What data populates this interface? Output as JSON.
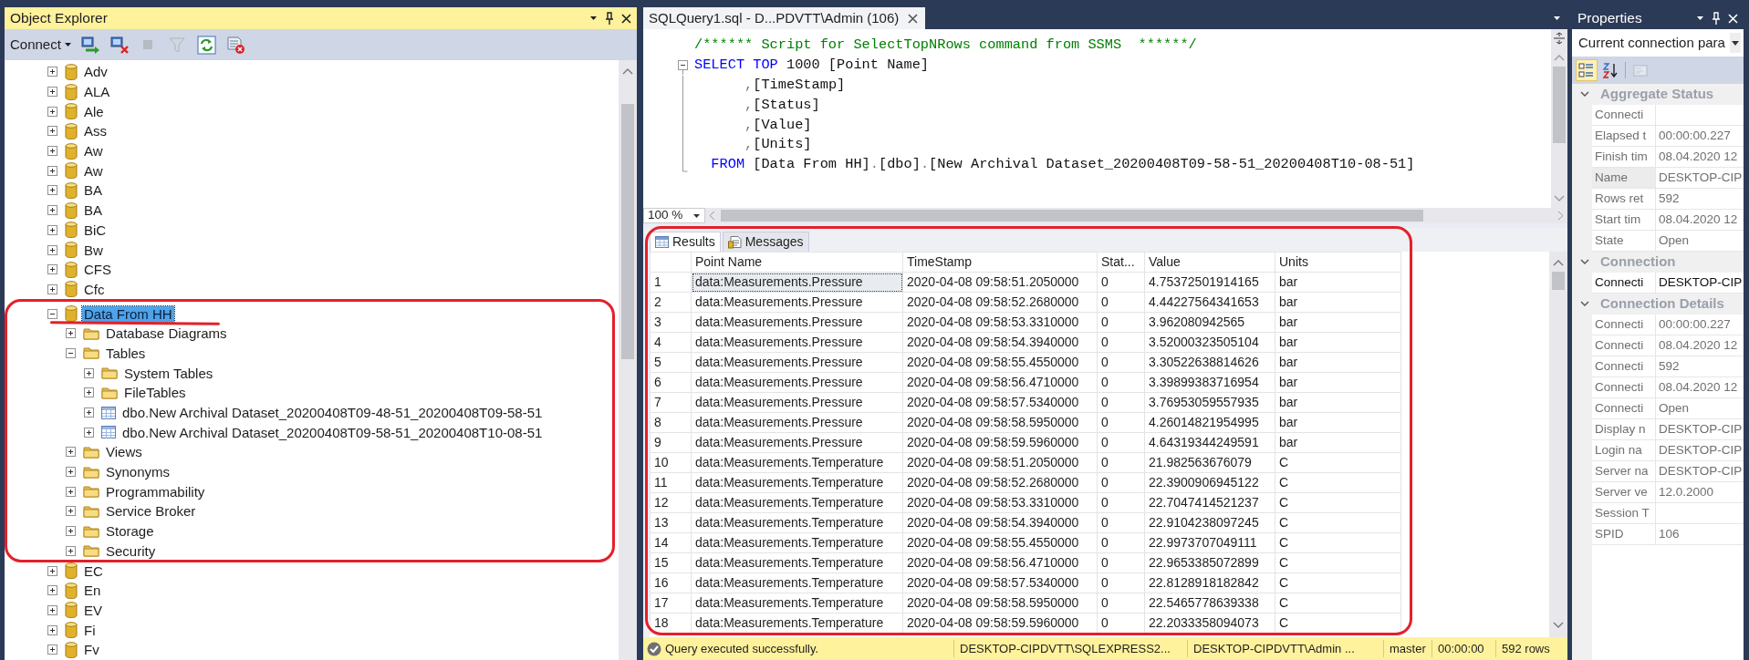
{
  "object_explorer": {
    "title": "Object Explorer",
    "active": true,
    "toolbar": {
      "connect": "Connect",
      "buttons": [
        {
          "kind": "connect",
          "disabled": false
        },
        {
          "kind": "disconnect",
          "disabled": false
        },
        {
          "kind": "stop",
          "disabled": true
        },
        {
          "kind": "filter",
          "disabled": true
        },
        {
          "kind": "refresh",
          "disabled": false
        },
        {
          "kind": "remove",
          "disabled": false
        }
      ]
    },
    "tree": [
      {
        "label": "Adv",
        "kind": "database",
        "expanded": false,
        "selected": false
      },
      {
        "label": "ALA",
        "kind": "database",
        "expanded": false,
        "selected": false
      },
      {
        "label": "Ale",
        "kind": "database",
        "expanded": false,
        "selected": false
      },
      {
        "label": "Ass",
        "kind": "database",
        "expanded": false,
        "selected": false
      },
      {
        "label": "Aw",
        "kind": "database",
        "expanded": false,
        "selected": false
      },
      {
        "label": "Aw",
        "kind": "database",
        "expanded": false,
        "selected": false
      },
      {
        "label": "BA",
        "kind": "database",
        "expanded": false,
        "selected": false
      },
      {
        "label": "BA",
        "kind": "database",
        "expanded": false,
        "selected": false
      },
      {
        "label": "BiC",
        "kind": "database",
        "expanded": false,
        "selected": false
      },
      {
        "label": "Bw",
        "kind": "database",
        "expanded": false,
        "selected": false
      },
      {
        "label": "CFS",
        "kind": "database",
        "expanded": false,
        "selected": false
      },
      {
        "label": "Cfc",
        "kind": "database",
        "expanded": false,
        "selected": false
      },
      {
        "label": "Data From HH",
        "kind": "database",
        "expanded": true,
        "selected": true,
        "outlined": true,
        "underlined": true,
        "children": [
          {
            "label": "Database Diagrams",
            "kind": "folder",
            "expanded": false,
            "selected": false
          },
          {
            "label": "Tables",
            "kind": "folder",
            "expanded": true,
            "selected": false,
            "children": [
              {
                "label": "System Tables",
                "kind": "folder",
                "expanded": false,
                "selected": false
              },
              {
                "label": "FileTables",
                "kind": "folder",
                "expanded": false,
                "selected": false
              },
              {
                "label": "dbo.New Archival Dataset_20200408T09-48-51_20200408T09-58-51",
                "kind": "table",
                "expanded": false,
                "selected": false
              },
              {
                "label": "dbo.New Archival Dataset_20200408T09-58-51_20200408T10-08-51",
                "kind": "table",
                "expanded": false,
                "selected": false
              }
            ]
          },
          {
            "label": "Views",
            "kind": "folder",
            "expanded": false,
            "selected": false
          },
          {
            "label": "Synonyms",
            "kind": "folder",
            "expanded": false,
            "selected": false
          },
          {
            "label": "Programmability",
            "kind": "folder",
            "expanded": false,
            "selected": false
          },
          {
            "label": "Service Broker",
            "kind": "folder",
            "expanded": false,
            "selected": false
          },
          {
            "label": "Storage",
            "kind": "folder",
            "expanded": false,
            "selected": false
          },
          {
            "label": "Security",
            "kind": "folder",
            "expanded": false,
            "selected": false
          }
        ]
      },
      {
        "label": "EC",
        "kind": "database",
        "expanded": false,
        "selected": false
      },
      {
        "label": "En",
        "kind": "database",
        "expanded": false,
        "selected": false
      },
      {
        "label": "EV",
        "kind": "database",
        "expanded": false,
        "selected": false
      },
      {
        "label": "Fi",
        "kind": "database",
        "expanded": false,
        "selected": false
      },
      {
        "label": "Fv",
        "kind": "database",
        "expanded": false,
        "selected": false
      }
    ]
  },
  "editor": {
    "tab": {
      "title": "SQLQuery1.sql - D...PDVTT\\Admin (106)",
      "selected": true
    },
    "fold_expanded": true,
    "code": [
      {
        "kind": "plain",
        "tokens": [
          {
            "text": "/****** Script for SelectTopNRows command from SSMS  ******/",
            "kind": "comment"
          }
        ]
      },
      {
        "kind": "fold-start",
        "tokens": [
          {
            "text": "SELECT",
            "kind": "keyword"
          },
          {
            "text": " TOP",
            "kind": "keyword"
          },
          {
            "text": " 1000 [Point Name]",
            "kind": "plain"
          }
        ]
      },
      {
        "kind": "fold-inside",
        "tokens": [
          {
            "text": "      ,",
            "kind": "punct"
          },
          {
            "text": "[TimeStamp]",
            "kind": "plain"
          }
        ]
      },
      {
        "kind": "fold-inside",
        "tokens": [
          {
            "text": "      ,",
            "kind": "punct"
          },
          {
            "text": "[Status]",
            "kind": "plain"
          }
        ]
      },
      {
        "kind": "fold-inside",
        "tokens": [
          {
            "text": "      ,",
            "kind": "punct"
          },
          {
            "text": "[Value]",
            "kind": "plain"
          }
        ]
      },
      {
        "kind": "fold-inside",
        "tokens": [
          {
            "text": "      ,",
            "kind": "punct"
          },
          {
            "text": "[Units]",
            "kind": "plain"
          }
        ]
      },
      {
        "kind": "fold-end",
        "tokens": [
          {
            "text": "  FROM",
            "kind": "keyword"
          },
          {
            "text": " [Data From HH]",
            "kind": "plain"
          },
          {
            "text": ".",
            "kind": "punct"
          },
          {
            "text": "[dbo]",
            "kind": "plain"
          },
          {
            "text": ".",
            "kind": "punct"
          },
          {
            "text": "[New Archival Dataset_20200408T09-58-51_20200408T10-08-51]",
            "kind": "plain"
          }
        ]
      }
    ],
    "zoom": "100 %"
  },
  "results": {
    "outlined": true,
    "tabs": [
      {
        "label": "Results",
        "kind": "grid",
        "selected": true
      },
      {
        "label": "Messages",
        "kind": "messages",
        "selected": false
      }
    ],
    "columns": [
      "Point Name",
      "TimeStamp",
      "Stat...",
      "Value",
      "Units"
    ],
    "rows": [
      {
        "num": "1",
        "selected": true,
        "cells": [
          "data:Measurements.Pressure",
          "2020-04-08 09:58:51.2050000",
          "0",
          "4.75372501914165",
          "bar"
        ]
      },
      {
        "num": "2",
        "selected": false,
        "cells": [
          "data:Measurements.Pressure",
          "2020-04-08 09:58:52.2680000",
          "0",
          "4.44227564341653",
          "bar"
        ]
      },
      {
        "num": "3",
        "selected": false,
        "cells": [
          "data:Measurements.Pressure",
          "2020-04-08 09:58:53.3310000",
          "0",
          "3.962080942565",
          "bar"
        ]
      },
      {
        "num": "4",
        "selected": false,
        "cells": [
          "data:Measurements.Pressure",
          "2020-04-08 09:58:54.3940000",
          "0",
          "3.52000323505104",
          "bar"
        ]
      },
      {
        "num": "5",
        "selected": false,
        "cells": [
          "data:Measurements.Pressure",
          "2020-04-08 09:58:55.4550000",
          "0",
          "3.30522638814626",
          "bar"
        ]
      },
      {
        "num": "6",
        "selected": false,
        "cells": [
          "data:Measurements.Pressure",
          "2020-04-08 09:58:56.4710000",
          "0",
          "3.39899383716954",
          "bar"
        ]
      },
      {
        "num": "7",
        "selected": false,
        "cells": [
          "data:Measurements.Pressure",
          "2020-04-08 09:58:57.5340000",
          "0",
          "3.76953059557935",
          "bar"
        ]
      },
      {
        "num": "8",
        "selected": false,
        "cells": [
          "data:Measurements.Pressure",
          "2020-04-08 09:58:58.5950000",
          "0",
          "4.26014821954995",
          "bar"
        ]
      },
      {
        "num": "9",
        "selected": false,
        "cells": [
          "data:Measurements.Pressure",
          "2020-04-08 09:58:59.5960000",
          "0",
          "4.64319344249591",
          "bar"
        ]
      },
      {
        "num": "10",
        "selected": false,
        "cells": [
          "data:Measurements.Temperature",
          "2020-04-08 09:58:51.2050000",
          "0",
          "21.982563676079",
          "C"
        ]
      },
      {
        "num": "11",
        "selected": false,
        "cells": [
          "data:Measurements.Temperature",
          "2020-04-08 09:58:52.2680000",
          "0",
          "22.3900906945122",
          "C"
        ]
      },
      {
        "num": "12",
        "selected": false,
        "cells": [
          "data:Measurements.Temperature",
          "2020-04-08 09:58:53.3310000",
          "0",
          "22.7047414521237",
          "C"
        ]
      },
      {
        "num": "13",
        "selected": false,
        "cells": [
          "data:Measurements.Temperature",
          "2020-04-08 09:58:54.3940000",
          "0",
          "22.9104238097245",
          "C"
        ]
      },
      {
        "num": "14",
        "selected": false,
        "cells": [
          "data:Measurements.Temperature",
          "2020-04-08 09:58:55.4550000",
          "0",
          "22.9973707049111",
          "C"
        ]
      },
      {
        "num": "15",
        "selected": false,
        "cells": [
          "data:Measurements.Temperature",
          "2020-04-08 09:58:56.4710000",
          "0",
          "22.9653385072899",
          "C"
        ]
      },
      {
        "num": "16",
        "selected": false,
        "cells": [
          "data:Measurements.Temperature",
          "2020-04-08 09:58:57.5340000",
          "0",
          "22.8128918182842",
          "C"
        ]
      },
      {
        "num": "17",
        "selected": false,
        "cells": [
          "data:Measurements.Temperature",
          "2020-04-08 09:58:58.5950000",
          "0",
          "22.5465778639338",
          "C"
        ]
      },
      {
        "num": "18",
        "selected": false,
        "cells": [
          "data:Measurements.Temperature",
          "2020-04-08 09:58:59.5960000",
          "0",
          "22.2033358094073",
          "C"
        ]
      }
    ]
  },
  "status_bar": {
    "kind": "success",
    "message": "Query executed successfully.",
    "items": [
      "DESKTOP-CIPDVTT\\SQLEXPRESS2...",
      "DESKTOP-CIPDVTT\\Admin ...",
      "master",
      "00:00:00",
      "592 rows"
    ]
  },
  "properties": {
    "title": "Properties",
    "object": "Current connection para",
    "toolbar": [
      {
        "kind": "categorized",
        "selected": true,
        "disabled": false
      },
      {
        "kind": "alphabetical",
        "selected": false,
        "disabled": false
      },
      {
        "kind": "pages",
        "selected": false,
        "disabled": true
      }
    ],
    "categories": [
      {
        "label": "Aggregate Status",
        "expanded": true,
        "items": [
          {
            "name": "Connecti",
            "readonly": true,
            "selected": false
          },
          {
            "name": "Elapsed t",
            "value": "00:00:00.227",
            "readonly": true,
            "selected": false
          },
          {
            "name": "Finish tim",
            "value": "08.04.2020 12",
            "readonly": true,
            "selected": false
          },
          {
            "name": "Name",
            "value": "DESKTOP-CIP",
            "readonly": true,
            "selected": true
          },
          {
            "name": "Rows ret",
            "value": "592",
            "readonly": true,
            "selected": false
          },
          {
            "name": "Start tim",
            "value": "08.04.2020 12",
            "readonly": true,
            "selected": false
          },
          {
            "name": "State",
            "value": "Open",
            "readonly": true,
            "selected": false
          }
        ]
      },
      {
        "label": "Connection",
        "expanded": true,
        "items": [
          {
            "name": "Connecti",
            "value": "DESKTOP-CIP",
            "readonly": false,
            "selected": false
          }
        ]
      },
      {
        "label": "Connection Details",
        "expanded": true,
        "items": [
          {
            "name": "Connecti",
            "value": "00:00:00.227",
            "readonly": true,
            "selected": false
          },
          {
            "name": "Connecti",
            "value": "08.04.2020 12",
            "readonly": true,
            "selected": false
          },
          {
            "name": "Connecti",
            "value": "592",
            "readonly": true,
            "selected": false
          },
          {
            "name": "Connecti",
            "value": "08.04.2020 12",
            "readonly": true,
            "selected": false
          },
          {
            "name": "Connecti",
            "value": "Open",
            "readonly": true,
            "selected": false
          },
          {
            "name": "Display n",
            "value": "DESKTOP-CIP",
            "readonly": true,
            "selected": false
          },
          {
            "name": "Login na",
            "value": "DESKTOP-CIP",
            "readonly": true,
            "selected": false
          },
          {
            "name": "Server na",
            "value": "DESKTOP-CIP",
            "readonly": true,
            "selected": false
          },
          {
            "name": "Server ve",
            "value": "12.0.2000",
            "readonly": true,
            "selected": false
          },
          {
            "name": "Session T",
            "readonly": true,
            "selected": false
          },
          {
            "name": "SPID",
            "value": "106",
            "readonly": true,
            "selected": false
          }
        ]
      }
    ]
  }
}
